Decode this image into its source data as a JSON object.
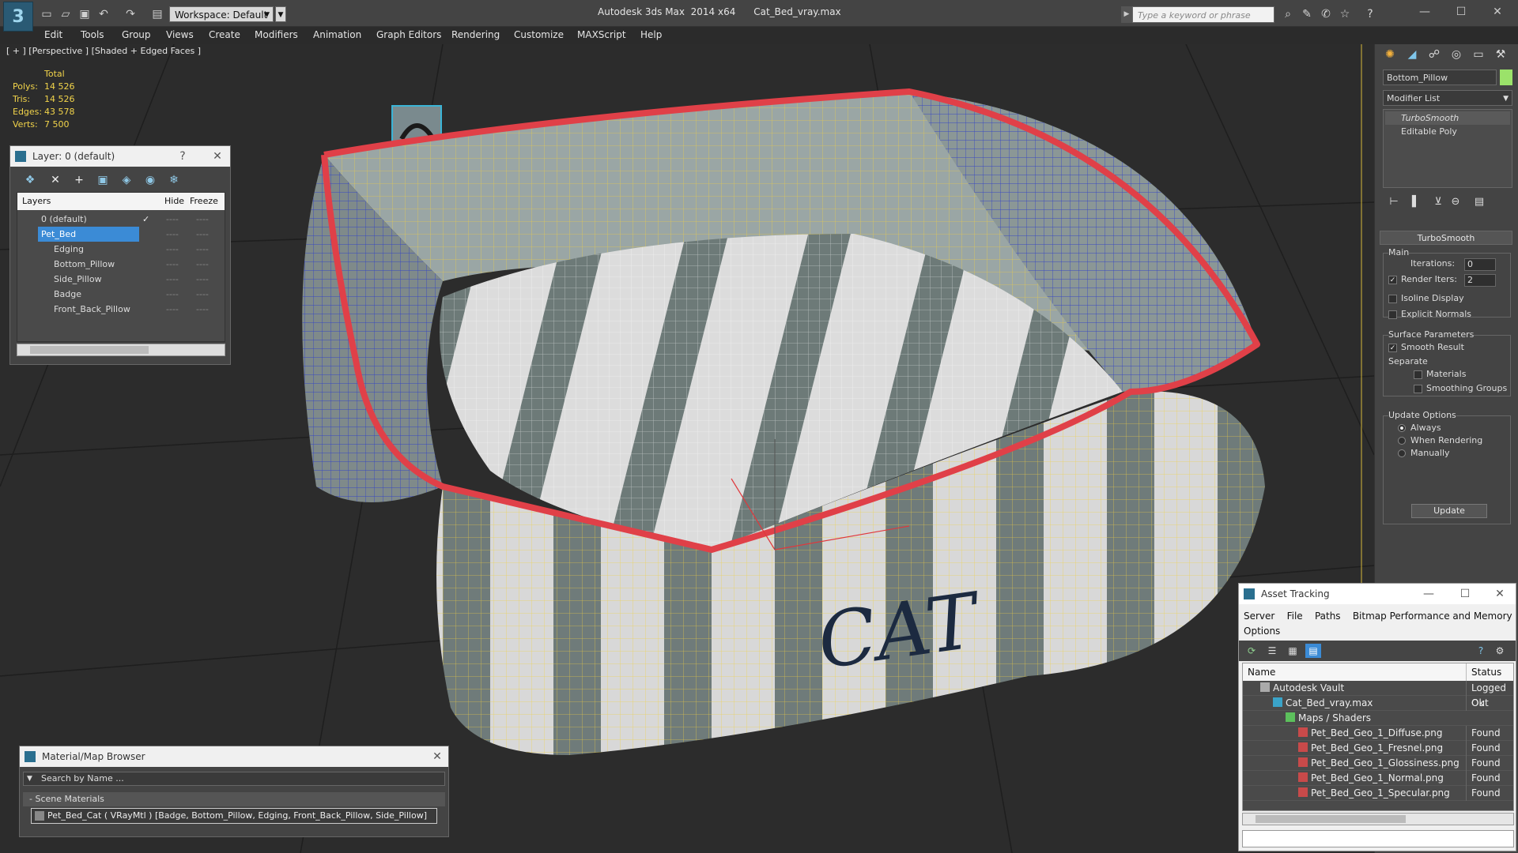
{
  "titlebar": {
    "workspace": "Workspace: Default",
    "app_title": "Autodesk 3ds Max  2014 x64      Cat_Bed_vray.max",
    "search_placeholder": "Type a keyword or phrase"
  },
  "menu": [
    "Edit",
    "Tools",
    "Group",
    "Views",
    "Create",
    "Modifiers",
    "Animation",
    "Graph Editors",
    "Rendering",
    "Customize",
    "MAXScript",
    "Help"
  ],
  "viewport": {
    "label": "[ + ] [Perspective ] [Shaded + Edged Faces ]",
    "stats": {
      "header": "Total",
      "rows": [
        {
          "label": "Polys:",
          "value": "14 526"
        },
        {
          "label": "Tris:",
          "value": "14 526"
        },
        {
          "label": "Edges:",
          "value": "43 578"
        },
        {
          "label": "Verts:",
          "value": "7 500"
        }
      ]
    },
    "model_text": "CAT"
  },
  "layer_panel": {
    "title": "Layer: 0 (default)",
    "help": "?",
    "close": "✕",
    "columns": {
      "layers": "Layers",
      "hide": "Hide",
      "freeze": "Freeze"
    },
    "rows": [
      {
        "name": "0 (default)",
        "indent": 0,
        "selected": false,
        "check": "✓"
      },
      {
        "name": "Pet_Bed",
        "indent": 0,
        "selected": true,
        "check": ""
      },
      {
        "name": "Edging",
        "indent": 1,
        "selected": false,
        "check": ""
      },
      {
        "name": "Bottom_Pillow",
        "indent": 1,
        "selected": false,
        "check": ""
      },
      {
        "name": "Side_Pillow",
        "indent": 1,
        "selected": false,
        "check": ""
      },
      {
        "name": "Badge",
        "indent": 1,
        "selected": false,
        "check": ""
      },
      {
        "name": "Front_Back_Pillow",
        "indent": 1,
        "selected": false,
        "check": ""
      }
    ],
    "dash": "----"
  },
  "command_panel": {
    "object_name": "Bottom_Pillow",
    "object_color": "#9be26a",
    "modifier_list": "Modifier List",
    "stack": [
      {
        "name": "TurboSmooth",
        "active": true
      },
      {
        "name": "Editable Poly",
        "active": false
      }
    ],
    "rollout": "TurboSmooth",
    "main": {
      "label": "Main",
      "iterations_label": "Iterations:",
      "iterations": "0",
      "render_iters_label": "Render Iters:",
      "render_iters": "2",
      "isoline": "Isoline Display",
      "explicit": "Explicit Normals"
    },
    "surface": {
      "label": "Surface Parameters",
      "smooth_result": "Smooth Result",
      "separate": "Separate",
      "materials": "Materials",
      "smoothing_groups": "Smoothing Groups"
    },
    "update": {
      "label": "Update Options",
      "always": "Always",
      "when_rendering": "When Rendering",
      "manually": "Manually",
      "button": "Update"
    }
  },
  "asset_panel": {
    "title": "Asset Tracking",
    "menu_line1": "Server    File    Paths    Bitmap Performance and Memory",
    "menu_line2": "Options",
    "columns": {
      "name": "Name",
      "status": "Status"
    },
    "rows": [
      {
        "name": "Autodesk Vault",
        "status": "Logged Out",
        "indent": 1,
        "icon": "vault-icon"
      },
      {
        "name": "Cat_Bed_vray.max",
        "status": "Ok",
        "indent": 2,
        "icon": "max-file-icon"
      },
      {
        "name": "Maps / Shaders",
        "status": "",
        "indent": 3,
        "icon": "maps-icon"
      },
      {
        "name": "Pet_Bed_Geo_1_Diffuse.png",
        "status": "Found",
        "indent": 4,
        "icon": "png-icon"
      },
      {
        "name": "Pet_Bed_Geo_1_Fresnel.png",
        "status": "Found",
        "indent": 4,
        "icon": "png-icon"
      },
      {
        "name": "Pet_Bed_Geo_1_Glossiness.png",
        "status": "Found",
        "indent": 4,
        "icon": "png-icon"
      },
      {
        "name": "Pet_Bed_Geo_1_Normal.png",
        "status": "Found",
        "indent": 4,
        "icon": "png-icon"
      },
      {
        "name": "Pet_Bed_Geo_1_Specular.png",
        "status": "Found",
        "indent": 4,
        "icon": "png-icon"
      }
    ]
  },
  "material_panel": {
    "title": "Material/Map Browser",
    "search_placeholder": "Search by Name ...",
    "group": "- Scene Materials",
    "item": "Pet_Bed_Cat  ( VRayMtl )  [Badge, Bottom_Pillow, Edging, Front_Back_Pillow, Side_Pillow]"
  }
}
